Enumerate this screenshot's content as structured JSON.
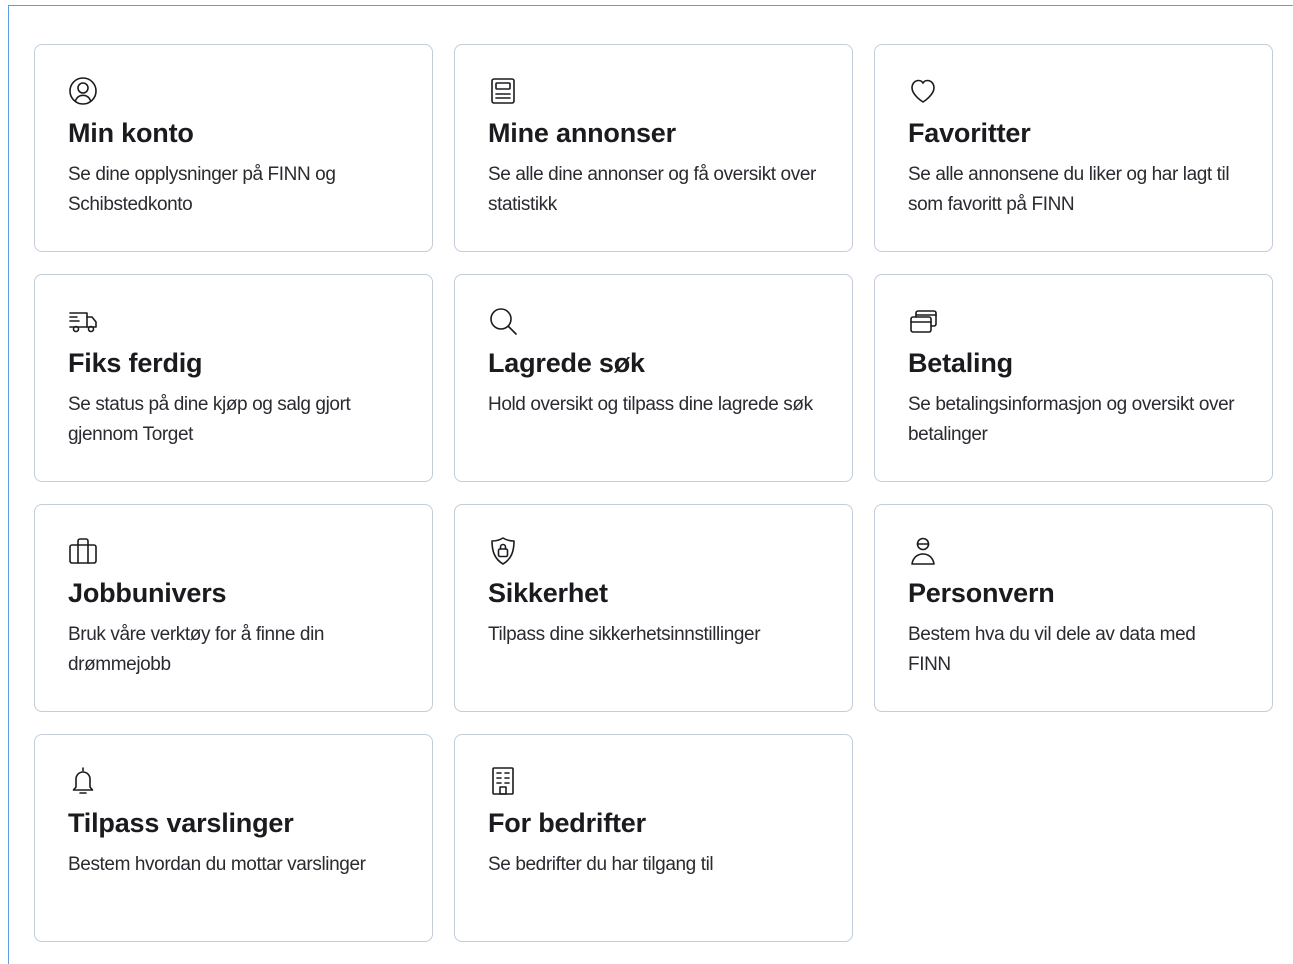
{
  "cards": [
    {
      "icon": "user-circle-icon",
      "title": "Min konto",
      "desc": "Se dine opplysninger på FINN og Schibstedkonto"
    },
    {
      "icon": "listing-icon",
      "title": "Mine annonser",
      "desc": "Se alle dine annonser og få oversikt over statistikk"
    },
    {
      "icon": "heart-icon",
      "title": "Favoritter",
      "desc": "Se alle annonsene du liker og har lagt til som favoritt på FINN"
    },
    {
      "icon": "delivery-truck-icon",
      "title": "Fiks ferdig",
      "desc": "Se status på dine kjøp og salg gjort gjennom Torget"
    },
    {
      "icon": "search-icon",
      "title": "Lagrede søk",
      "desc": "Hold oversikt og tilpass dine lagrede søk"
    },
    {
      "icon": "credit-cards-icon",
      "title": "Betaling",
      "desc": "Se betalingsinformasjon og oversikt over betalinger"
    },
    {
      "icon": "briefcase-icon",
      "title": "Jobbunivers",
      "desc": "Bruk våre verktøy for å finne din drømmejobb"
    },
    {
      "icon": "shield-lock-icon",
      "title": "Sikkerhet",
      "desc": "Tilpass dine sikkerhetsinnstillinger"
    },
    {
      "icon": "person-icon",
      "title": "Personvern",
      "desc": "Bestem hva du vil dele av data med FINN"
    },
    {
      "icon": "bell-icon",
      "title": "Tilpass varslinger",
      "desc": "Bestem hvordan du mottar varslinger"
    },
    {
      "icon": "building-icon",
      "title": "For bedrifter",
      "desc": "Se bedrifter du har tilgang til"
    }
  ],
  "colors": {
    "card_border": "#c3ccd9",
    "frame_border": "#5aa0e6",
    "title_text": "#1b1b1f",
    "icon_stroke": "#1b1b1f"
  }
}
